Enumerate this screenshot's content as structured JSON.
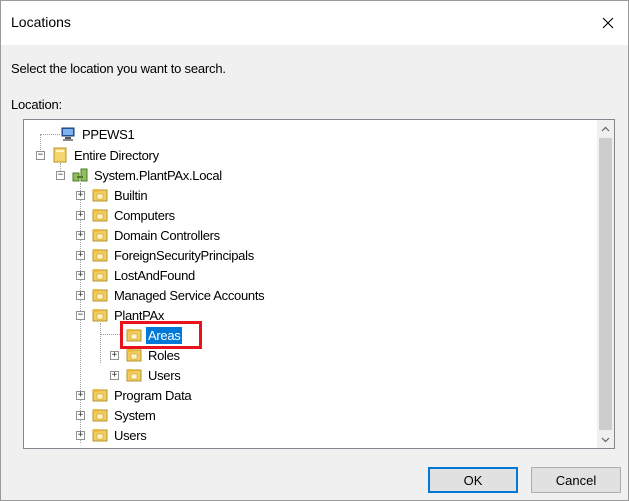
{
  "window": {
    "title": "Locations"
  },
  "prompt": "Select the location you want to search.",
  "location_label": "Location:",
  "tree": {
    "root_computer": "PPEWS1",
    "entire_directory": "Entire Directory",
    "domain": "System.PlantPAx.Local",
    "ous": {
      "builtin": "Builtin",
      "computers": "Computers",
      "domain_controllers": "Domain Controllers",
      "foreign_security_principals": "ForeignSecurityPrincipals",
      "lost_and_found": "LostAndFound",
      "managed_service_accounts": "Managed Service Accounts",
      "plantpax": "PlantPAx",
      "areas": "Areas",
      "roles": "Roles",
      "users_sub": "Users",
      "program_data": "Program Data",
      "system": "System",
      "users": "Users"
    },
    "selected": "Areas"
  },
  "buttons": {
    "ok": "OK",
    "cancel": "Cancel"
  },
  "colors": {
    "selection": "#0078d7",
    "highlight_border": "#e8121b"
  }
}
